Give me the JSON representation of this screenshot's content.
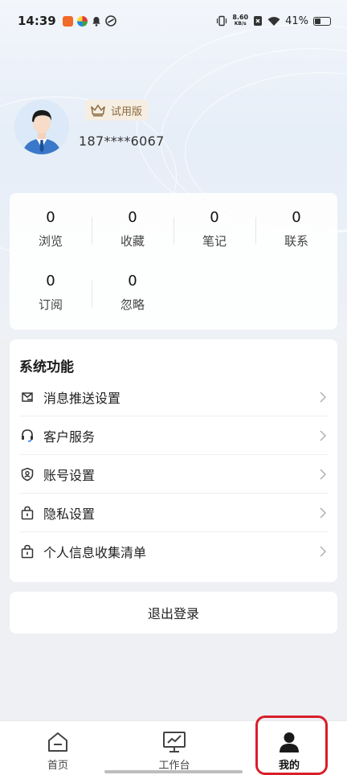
{
  "status_bar": {
    "time": "14:39",
    "net_speed_value": "8.60",
    "net_speed_unit": "KB/s",
    "battery": "41%",
    "battery_level": 0.41
  },
  "profile": {
    "badge_label": "试用版",
    "phone": "187****6067"
  },
  "stats": [
    {
      "value": "0",
      "label": "浏览"
    },
    {
      "value": "0",
      "label": "收藏"
    },
    {
      "value": "0",
      "label": "笔记"
    },
    {
      "value": "0",
      "label": "联系"
    },
    {
      "value": "0",
      "label": "订阅"
    },
    {
      "value": "0",
      "label": "忽略"
    }
  ],
  "functions": {
    "title": "系统功能",
    "items": [
      {
        "label": "消息推送设置",
        "icon": "message-icon"
      },
      {
        "label": "客户服务",
        "icon": "headset-icon"
      },
      {
        "label": "账号设置",
        "icon": "account-shield-icon"
      },
      {
        "label": "隐私设置",
        "icon": "lock-bag-icon"
      },
      {
        "label": "个人信息收集清单",
        "icon": "lock-bag-icon"
      }
    ]
  },
  "logout_label": "退出登录",
  "tabs": [
    {
      "label": "首页",
      "icon": "home-icon"
    },
    {
      "label": "工作台",
      "icon": "monitor-chart-icon"
    },
    {
      "label": "我的",
      "icon": "user-icon",
      "active": true
    }
  ],
  "colors": {
    "highlight": "#d81e2a",
    "badge_text": "#8a6a3e",
    "badge_bg": "#f6eee2"
  }
}
